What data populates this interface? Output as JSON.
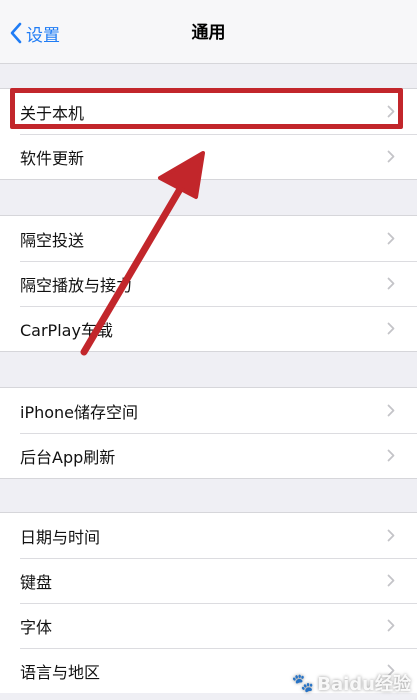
{
  "navbar": {
    "back_label": "设置",
    "title": "通用"
  },
  "groups": [
    {
      "items": [
        {
          "label": "关于本机"
        },
        {
          "label": "软件更新"
        }
      ]
    },
    {
      "items": [
        {
          "label": "隔空投送"
        },
        {
          "label": "隔空播放与接力"
        },
        {
          "label": "CarPlay车载"
        }
      ]
    },
    {
      "items": [
        {
          "label": "iPhone储存空间"
        },
        {
          "label": "后台App刷新"
        }
      ]
    },
    {
      "items": [
        {
          "label": "日期与时间"
        },
        {
          "label": "键盘"
        },
        {
          "label": "字体"
        },
        {
          "label": "语言与地区"
        }
      ]
    }
  ],
  "annotation": {
    "color": "#c2262b"
  },
  "watermark": "Baidu经验",
  "colors": {
    "accent": "#1f7cf5",
    "background": "#efeff4"
  }
}
